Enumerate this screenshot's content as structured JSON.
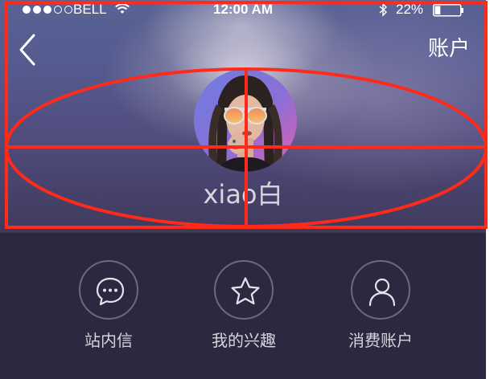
{
  "status_bar": {
    "carrier": "BELL",
    "time": "12:00 AM",
    "battery_percent": "22%",
    "battery_level": 0.22,
    "signal_strength": 3
  },
  "nav": {
    "account_label": "账户"
  },
  "profile": {
    "username": "xiao白"
  },
  "menu": {
    "items": [
      {
        "label": "站内信",
        "icon": "message-bubble-icon"
      },
      {
        "label": "我的兴趣",
        "icon": "star-icon"
      },
      {
        "label": "消费账户",
        "icon": "user-icon"
      }
    ]
  },
  "colors": {
    "background": "#2d2840",
    "annotation_red": "#ff2a1a",
    "icon_circle": "#6f6884"
  }
}
